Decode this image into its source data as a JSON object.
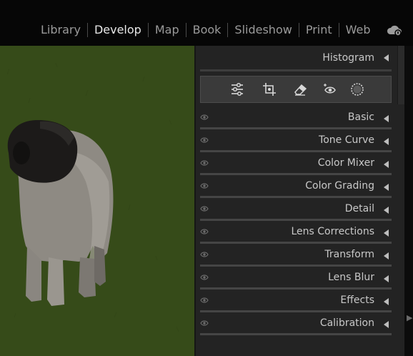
{
  "modules": [
    {
      "label": "Library",
      "active": false
    },
    {
      "label": "Develop",
      "active": true
    },
    {
      "label": "Map",
      "active": false
    },
    {
      "label": "Book",
      "active": false
    },
    {
      "label": "Slideshow",
      "active": false
    },
    {
      "label": "Print",
      "active": false
    },
    {
      "label": "Web",
      "active": false
    }
  ],
  "cloud_icon": "cloud-sync-icon",
  "panel": {
    "histogram_label": "Histogram",
    "tools": [
      "edit-sliders-icon",
      "crop-icon",
      "eraser-icon",
      "red-eye-icon",
      "masking-icon"
    ],
    "sections": [
      {
        "label": "Basic"
      },
      {
        "label": "Tone Curve"
      },
      {
        "label": "Color Mixer"
      },
      {
        "label": "Color Grading"
      },
      {
        "label": "Detail"
      },
      {
        "label": "Lens Corrections"
      },
      {
        "label": "Transform"
      },
      {
        "label": "Lens Blur"
      },
      {
        "label": "Effects"
      },
      {
        "label": "Calibration"
      }
    ]
  },
  "colors": {
    "background": "#000000",
    "panel": "#232323",
    "active_text": "#e8e8e8",
    "inactive_text": "#9a9a9a",
    "grass": "#354a19"
  }
}
